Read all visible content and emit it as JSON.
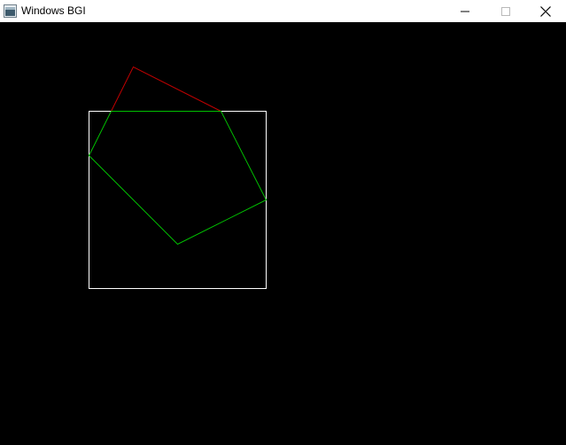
{
  "window": {
    "title": "Windows BGI",
    "icon": "app-window-icon",
    "controls": [
      "minimize-icon",
      "maximize-icon",
      "close-icon"
    ]
  },
  "canvas": {
    "background": "#000000",
    "shapes": [
      {
        "name": "square-outline",
        "color": "#ffffff"
      },
      {
        "name": "original-pentagon",
        "color": "#c00000"
      },
      {
        "name": "clipped-pentagon",
        "color": "#00c000"
      }
    ]
  }
}
